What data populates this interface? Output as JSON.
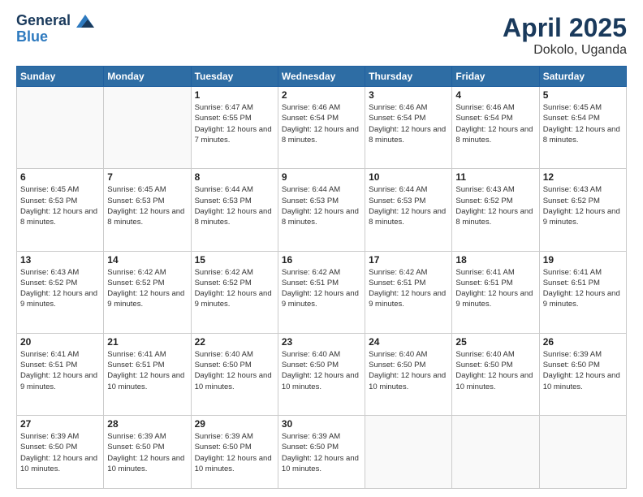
{
  "logo": {
    "line1": "General",
    "line2": "Blue"
  },
  "title": "April 2025",
  "location": "Dokolo, Uganda",
  "weekdays": [
    "Sunday",
    "Monday",
    "Tuesday",
    "Wednesday",
    "Thursday",
    "Friday",
    "Saturday"
  ],
  "rows": [
    [
      {
        "day": "",
        "text": ""
      },
      {
        "day": "",
        "text": ""
      },
      {
        "day": "1",
        "text": "Sunrise: 6:47 AM\nSunset: 6:55 PM\nDaylight: 12 hours and 7 minutes."
      },
      {
        "day": "2",
        "text": "Sunrise: 6:46 AM\nSunset: 6:54 PM\nDaylight: 12 hours and 8 minutes."
      },
      {
        "day": "3",
        "text": "Sunrise: 6:46 AM\nSunset: 6:54 PM\nDaylight: 12 hours and 8 minutes."
      },
      {
        "day": "4",
        "text": "Sunrise: 6:46 AM\nSunset: 6:54 PM\nDaylight: 12 hours and 8 minutes."
      },
      {
        "day": "5",
        "text": "Sunrise: 6:45 AM\nSunset: 6:54 PM\nDaylight: 12 hours and 8 minutes."
      }
    ],
    [
      {
        "day": "6",
        "text": "Sunrise: 6:45 AM\nSunset: 6:53 PM\nDaylight: 12 hours and 8 minutes."
      },
      {
        "day": "7",
        "text": "Sunrise: 6:45 AM\nSunset: 6:53 PM\nDaylight: 12 hours and 8 minutes."
      },
      {
        "day": "8",
        "text": "Sunrise: 6:44 AM\nSunset: 6:53 PM\nDaylight: 12 hours and 8 minutes."
      },
      {
        "day": "9",
        "text": "Sunrise: 6:44 AM\nSunset: 6:53 PM\nDaylight: 12 hours and 8 minutes."
      },
      {
        "day": "10",
        "text": "Sunrise: 6:44 AM\nSunset: 6:53 PM\nDaylight: 12 hours and 8 minutes."
      },
      {
        "day": "11",
        "text": "Sunrise: 6:43 AM\nSunset: 6:52 PM\nDaylight: 12 hours and 8 minutes."
      },
      {
        "day": "12",
        "text": "Sunrise: 6:43 AM\nSunset: 6:52 PM\nDaylight: 12 hours and 9 minutes."
      }
    ],
    [
      {
        "day": "13",
        "text": "Sunrise: 6:43 AM\nSunset: 6:52 PM\nDaylight: 12 hours and 9 minutes."
      },
      {
        "day": "14",
        "text": "Sunrise: 6:42 AM\nSunset: 6:52 PM\nDaylight: 12 hours and 9 minutes."
      },
      {
        "day": "15",
        "text": "Sunrise: 6:42 AM\nSunset: 6:52 PM\nDaylight: 12 hours and 9 minutes."
      },
      {
        "day": "16",
        "text": "Sunrise: 6:42 AM\nSunset: 6:51 PM\nDaylight: 12 hours and 9 minutes."
      },
      {
        "day": "17",
        "text": "Sunrise: 6:42 AM\nSunset: 6:51 PM\nDaylight: 12 hours and 9 minutes."
      },
      {
        "day": "18",
        "text": "Sunrise: 6:41 AM\nSunset: 6:51 PM\nDaylight: 12 hours and 9 minutes."
      },
      {
        "day": "19",
        "text": "Sunrise: 6:41 AM\nSunset: 6:51 PM\nDaylight: 12 hours and 9 minutes."
      }
    ],
    [
      {
        "day": "20",
        "text": "Sunrise: 6:41 AM\nSunset: 6:51 PM\nDaylight: 12 hours and 9 minutes."
      },
      {
        "day": "21",
        "text": "Sunrise: 6:41 AM\nSunset: 6:51 PM\nDaylight: 12 hours and 10 minutes."
      },
      {
        "day": "22",
        "text": "Sunrise: 6:40 AM\nSunset: 6:50 PM\nDaylight: 12 hours and 10 minutes."
      },
      {
        "day": "23",
        "text": "Sunrise: 6:40 AM\nSunset: 6:50 PM\nDaylight: 12 hours and 10 minutes."
      },
      {
        "day": "24",
        "text": "Sunrise: 6:40 AM\nSunset: 6:50 PM\nDaylight: 12 hours and 10 minutes."
      },
      {
        "day": "25",
        "text": "Sunrise: 6:40 AM\nSunset: 6:50 PM\nDaylight: 12 hours and 10 minutes."
      },
      {
        "day": "26",
        "text": "Sunrise: 6:39 AM\nSunset: 6:50 PM\nDaylight: 12 hours and 10 minutes."
      }
    ],
    [
      {
        "day": "27",
        "text": "Sunrise: 6:39 AM\nSunset: 6:50 PM\nDaylight: 12 hours and 10 minutes."
      },
      {
        "day": "28",
        "text": "Sunrise: 6:39 AM\nSunset: 6:50 PM\nDaylight: 12 hours and 10 minutes."
      },
      {
        "day": "29",
        "text": "Sunrise: 6:39 AM\nSunset: 6:50 PM\nDaylight: 12 hours and 10 minutes."
      },
      {
        "day": "30",
        "text": "Sunrise: 6:39 AM\nSunset: 6:50 PM\nDaylight: 12 hours and 10 minutes."
      },
      {
        "day": "",
        "text": ""
      },
      {
        "day": "",
        "text": ""
      },
      {
        "day": "",
        "text": ""
      }
    ]
  ]
}
